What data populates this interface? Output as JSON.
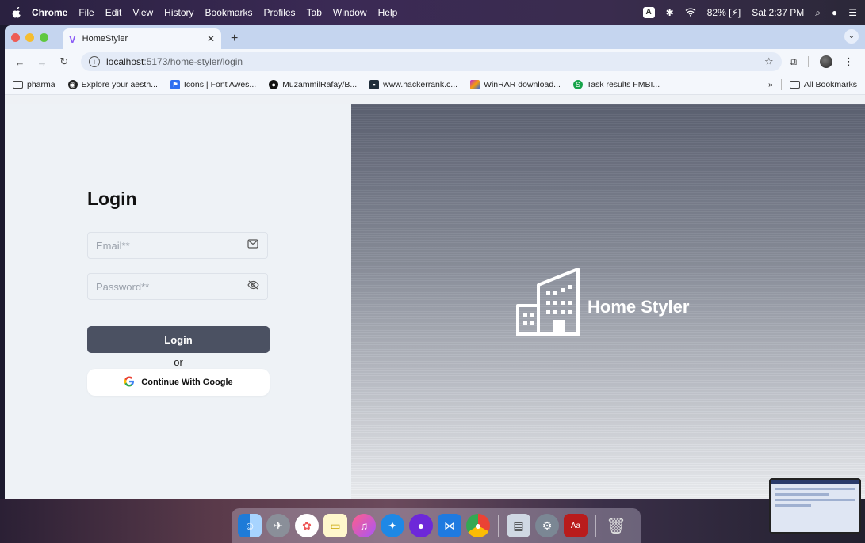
{
  "menubar": {
    "app": "Chrome",
    "items": [
      "File",
      "Edit",
      "View",
      "History",
      "Bookmarks",
      "Profiles",
      "Tab",
      "Window",
      "Help"
    ],
    "input_badge": "A",
    "battery": "82%",
    "clock": "Sat 2:37 PM"
  },
  "browser": {
    "tab_title": "HomeStyler",
    "url_host": "localhost",
    "url_path": ":5173/home-styler/login",
    "bookmarks": [
      {
        "label": "pharma",
        "icon": "folder-icon"
      },
      {
        "label": "Explore your aesth...",
        "icon": "compass-icon"
      },
      {
        "label": "Icons | Font Awes...",
        "icon": "fontawesome-icon"
      },
      {
        "label": "MuzammilRafay/B...",
        "icon": "github-icon"
      },
      {
        "label": "www.hackerrank.c...",
        "icon": "hackerrank-icon"
      },
      {
        "label": "WinRAR download...",
        "icon": "winrar-icon"
      },
      {
        "label": "Task results FMBI...",
        "icon": "task-icon"
      }
    ],
    "more_bookmarks": "»",
    "all_bookmarks": "All Bookmarks"
  },
  "login": {
    "title": "Login",
    "email_placeholder": "Email**",
    "password_placeholder": "Password**",
    "login_button": "Login",
    "or_text": "or",
    "google_button": "Continue With Google"
  },
  "brand": {
    "name": "Home Styler"
  },
  "colors": {
    "primary_button": "#4b5162",
    "left_bg": "#eef2f6",
    "right_gradient_top": "#5d6273",
    "right_gradient_bottom": "#eef0f3"
  }
}
